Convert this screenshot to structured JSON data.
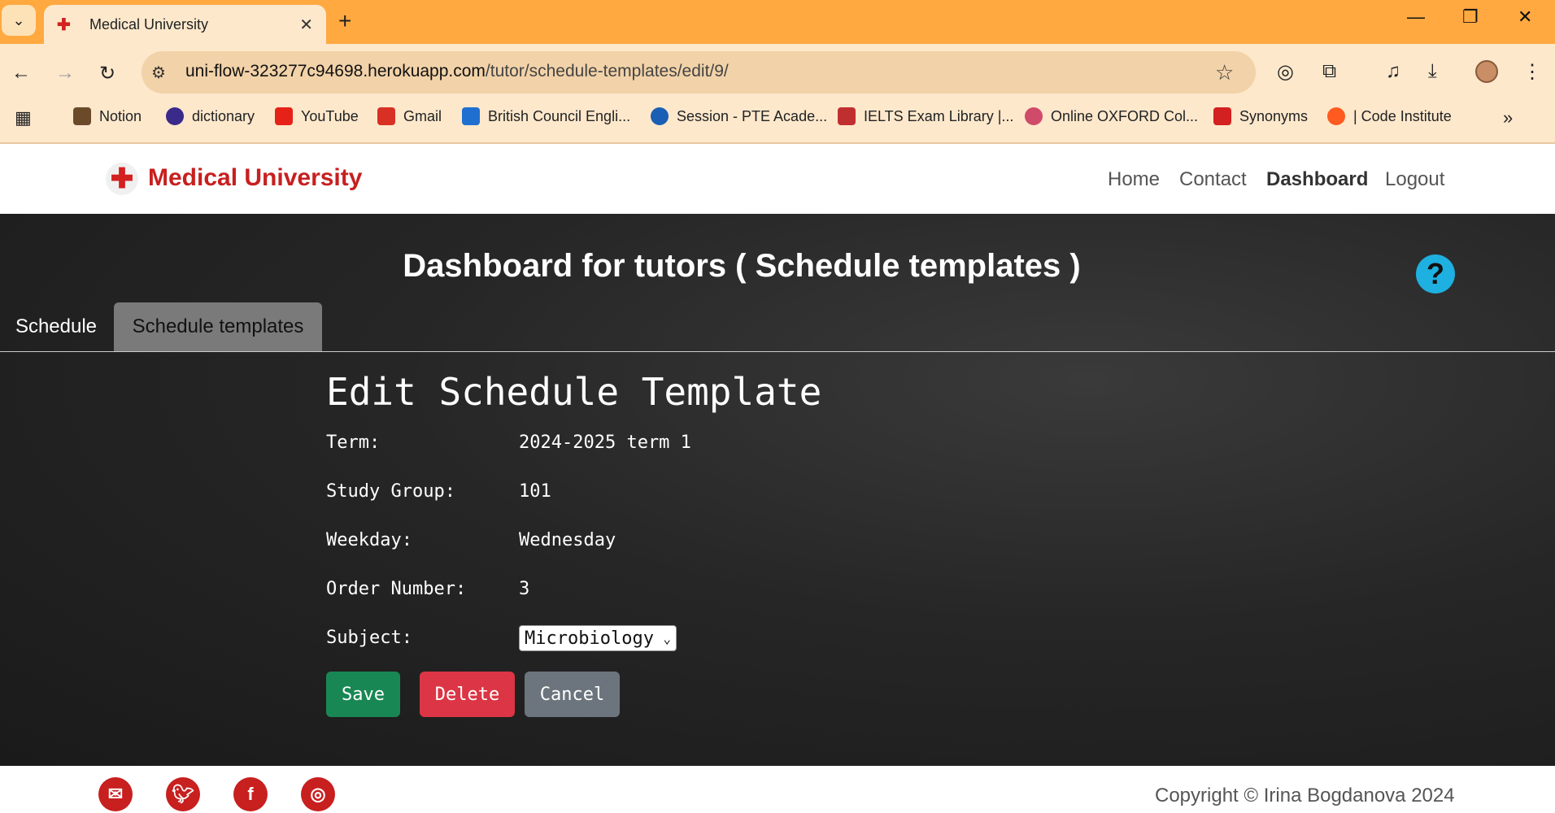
{
  "browser": {
    "tab_title": "Medical University",
    "new_tab_symbol": "+",
    "url_host": "uni-flow-323277c94698.herokuapp.com",
    "url_path": "/tutor/schedule-templates/edit/9/",
    "bookmarks": [
      {
        "label": "Notion",
        "color": "#6b4a2a"
      },
      {
        "label": "dictionary",
        "color": "#3a2a8a"
      },
      {
        "label": "YouTube",
        "color": "#e62117"
      },
      {
        "label": "Gmail",
        "color": "#d93025"
      },
      {
        "label": "British Council Engli...",
        "color": "#1f6fd1"
      },
      {
        "label": "Session - PTE Acade...",
        "color": "#1a5fb4"
      },
      {
        "label": "IELTS Exam Library |...",
        "color": "#c02f2f"
      },
      {
        "label": "Online OXFORD Col...",
        "color": "#d04a6a"
      },
      {
        "label": "Synonyms",
        "color": "#d32020"
      },
      {
        "label": "| Code Institute",
        "color": "#ff5a1f"
      }
    ]
  },
  "site": {
    "brand": "Medical University",
    "nav": [
      "Home",
      "Contact",
      "Dashboard",
      "Logout"
    ],
    "active_nav": "Dashboard"
  },
  "dashboard": {
    "title": "Dashboard for tutors ( Schedule templates )",
    "help_symbol": "?",
    "tabs": [
      "Schedule",
      "Schedule templates"
    ],
    "active_tab": "Schedule templates"
  },
  "form": {
    "heading": "Edit Schedule Template",
    "fields": [
      {
        "label": "Term:",
        "value": "2024-2025 term 1"
      },
      {
        "label": "Study Group:",
        "value": "101"
      },
      {
        "label": "Weekday:",
        "value": "Wednesday"
      },
      {
        "label": "Order Number:",
        "value": "3"
      }
    ],
    "subject_label": "Subject:",
    "subject_value": "Microbiology",
    "buttons": {
      "save": "Save",
      "delete": "Delete",
      "cancel": "Cancel"
    }
  },
  "footer": {
    "copyright": "Copyright © Irina Bogdanova 2024",
    "accent_color": "#c81f1f"
  }
}
